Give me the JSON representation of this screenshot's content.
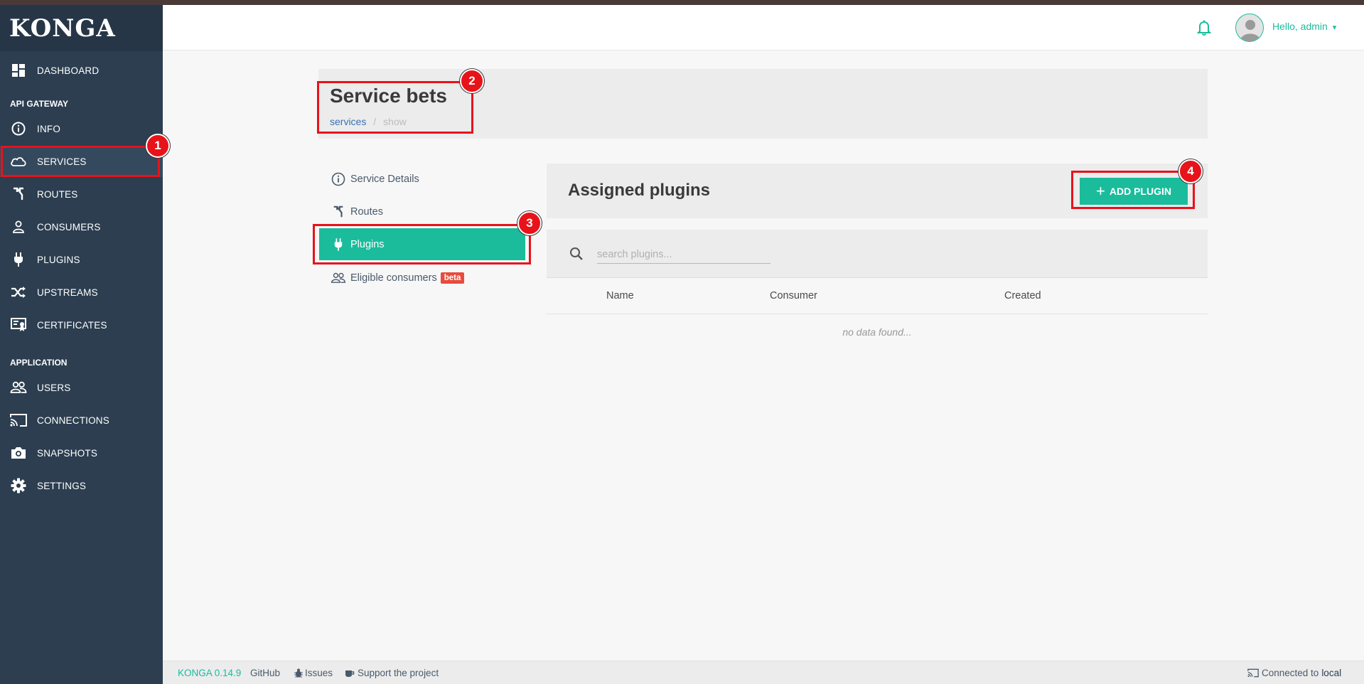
{
  "brand": {
    "logo": "KONGA"
  },
  "sidebar": {
    "sections": [
      {
        "label": "API GATEWAY"
      },
      {
        "label": "APPLICATION"
      }
    ],
    "items": [
      {
        "label": "DASHBOARD",
        "icon": "dashboard-icon"
      },
      {
        "label": "INFO",
        "icon": "info-icon"
      },
      {
        "label": "SERVICES",
        "icon": "cloud-icon",
        "active": true
      },
      {
        "label": "ROUTES",
        "icon": "routes-icon"
      },
      {
        "label": "CONSUMERS",
        "icon": "user-icon"
      },
      {
        "label": "PLUGINS",
        "icon": "plug-icon"
      },
      {
        "label": "UPSTREAMS",
        "icon": "shuffle-icon"
      },
      {
        "label": "CERTIFICATES",
        "icon": "certificate-icon"
      },
      {
        "label": "USERS",
        "icon": "users-icon"
      },
      {
        "label": "CONNECTIONS",
        "icon": "cast-icon"
      },
      {
        "label": "SNAPSHOTS",
        "icon": "camera-icon"
      },
      {
        "label": "SETTINGS",
        "icon": "gear-icon"
      }
    ]
  },
  "header": {
    "greeting": "Hello, admin",
    "caret": "▾"
  },
  "page": {
    "title": "Service bets",
    "breadcrumb": {
      "link": "services",
      "separator": "/",
      "current": "show"
    }
  },
  "subnav": {
    "items": [
      {
        "label": "Service Details",
        "icon": "info-circle-icon"
      },
      {
        "label": "Routes",
        "icon": "routes-icon"
      },
      {
        "label": "Plugins",
        "icon": "plug-icon",
        "active": true
      },
      {
        "label": "Eligible consumers",
        "icon": "users-icon",
        "badge": "beta"
      }
    ]
  },
  "plugins": {
    "title": "Assigned plugins",
    "add_button": "ADD PLUGIN",
    "search_placeholder": "search plugins...",
    "columns": [
      "Name",
      "Consumer",
      "Created"
    ],
    "empty_text": "no data found..."
  },
  "footer": {
    "version": "KONGA 0.14.9",
    "github": "GitHub",
    "issues": "Issues",
    "support": "Support the project",
    "connected_prefix": "Connected to",
    "connection": "local"
  },
  "annotations": [
    "1",
    "2",
    "3",
    "4"
  ],
  "colors": {
    "accent": "#1abc9c",
    "sidebar": "#2c3e50",
    "marker": "#e8121a",
    "beta": "#e74c3c"
  }
}
